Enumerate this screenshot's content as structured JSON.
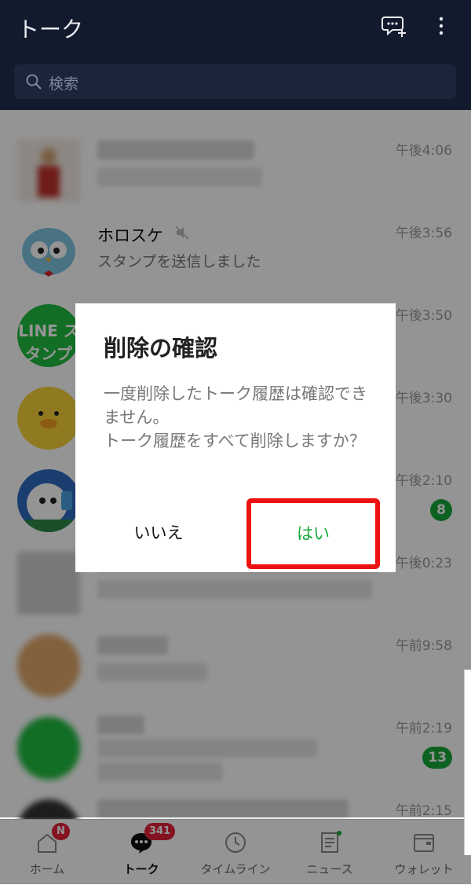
{
  "header": {
    "title": "トーク"
  },
  "search": {
    "placeholder": "検索"
  },
  "chats": [
    {
      "name": "",
      "message": "",
      "time": "午後4:06",
      "blurred": true
    },
    {
      "name": "ホロスケ",
      "message": "スタンプを送信しました",
      "time": "午後3:56",
      "muted": true
    },
    {
      "name": "",
      "message": "",
      "time": "午後3:50",
      "avatar_text": "LINE スタンプ"
    },
    {
      "name": "",
      "message": "",
      "time": "午後3:30"
    },
    {
      "name": "",
      "message": "",
      "time": "午後2:10",
      "badge": "8"
    },
    {
      "name": "",
      "message": "",
      "time": "午後0:23",
      "blurred": true
    },
    {
      "name": "",
      "message": "",
      "time": "午前9:58",
      "blurred": true
    },
    {
      "name": "",
      "message": "",
      "time": "午前2:19",
      "badge": "13",
      "blurred": true
    },
    {
      "name": "",
      "message": "",
      "time": "午前2:15",
      "blurred": true
    }
  ],
  "dialog": {
    "title": "削除の確認",
    "message": "一度削除したトーク履歴は確認できません。\nトーク履歴をすべて削除しますか？",
    "cancel_label": "いいえ",
    "confirm_label": "はい"
  },
  "tabs": [
    {
      "label": "ホーム",
      "badge": "N"
    },
    {
      "label": "トーク",
      "badge": "341",
      "active": true
    },
    {
      "label": "タイムライン"
    },
    {
      "label": "ニュース"
    },
    {
      "label": "ウォレット"
    }
  ],
  "colors": {
    "accent": "#19a93a",
    "header_bg": "#121a2d",
    "highlight": "#ee1111",
    "badge_red": "#e3213a"
  },
  "icons": [
    "new-chat-icon",
    "more-icon",
    "search-icon",
    "mute-icon",
    "home-icon",
    "talk-icon",
    "timeline-icon",
    "news-icon",
    "wallet-icon"
  ]
}
